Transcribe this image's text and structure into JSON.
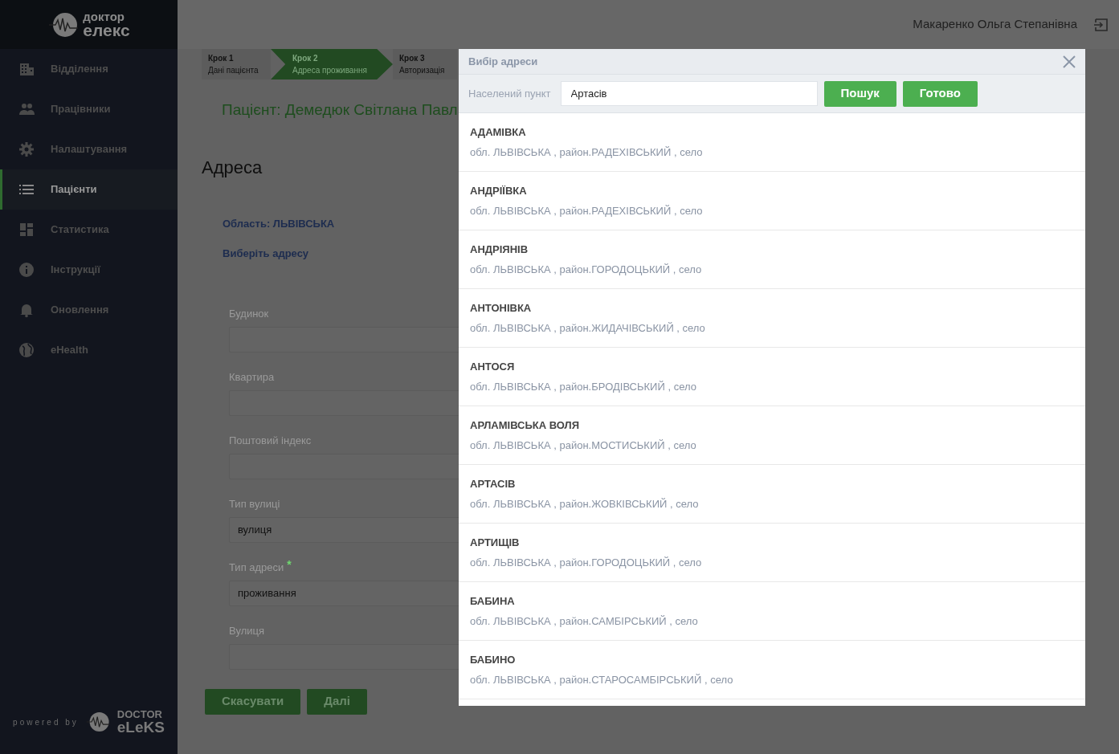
{
  "logo": {
    "line_1": "доктор",
    "line_2": "елекс"
  },
  "sidebar": {
    "items": [
      {
        "label": "Відділення",
        "selected": false
      },
      {
        "label": "Працівники",
        "selected": false
      },
      {
        "label": "Налаштування",
        "selected": false
      },
      {
        "label": "Пацієнти",
        "selected": true
      },
      {
        "label": "Статистика",
        "selected": false
      },
      {
        "label": "Інструкції",
        "selected": false
      },
      {
        "label": "Оновлення",
        "selected": false
      },
      {
        "label": "eHealth",
        "selected": false
      }
    ],
    "footer": {
      "powered_by": "powered by",
      "brand_line_1": "DOCTOR",
      "brand_line_2": "eLeKS"
    }
  },
  "header": {
    "user_name": "Макаренко Ольга Степанівна"
  },
  "steps": [
    {
      "title": "Крок 1",
      "subtitle": "Дані пацієнта",
      "selected": false
    },
    {
      "title": "Крок 2",
      "subtitle": "Адреса проживання",
      "selected": true
    },
    {
      "title": "Крок 3",
      "subtitle": "Авторизація",
      "selected": false
    }
  ],
  "patient_title": "Пацієнт: Демедюк Світлана Павл",
  "section_title": "Адреса",
  "region_label": "Область: ЛЬВІВСЬКА",
  "choose_address_link": "Виберіть адресу",
  "fields": [
    {
      "label": "Будинок",
      "required": false
    },
    {
      "label": "Квартира",
      "required": false
    },
    {
      "label": "Поштовий індекс",
      "required": false
    },
    {
      "label": "Тип вулиці",
      "value": "вулиця",
      "required": false
    },
    {
      "label": "Тип адреси",
      "value": "проживання",
      "required": true
    },
    {
      "label": "Вулиця",
      "required": false
    }
  ],
  "required_mark": "*",
  "buttons": [
    "Скасувати",
    "Далі"
  ],
  "modal": {
    "title": "Вибір адреси",
    "search_label": "Населений пункт",
    "search_value": "Артасів",
    "buttons": [
      "Пошук",
      "Готово"
    ],
    "results": [
      {
        "name": "АДАМІВКА",
        "details": "обл. ЛЬВІВСЬКА , район.РАДЕХІВСЬКИЙ , село"
      },
      {
        "name": "АНДРІЇВКА",
        "details": "обл. ЛЬВІВСЬКА , район.РАДЕХІВСЬКИЙ , село"
      },
      {
        "name": "АНДРІЯНІВ",
        "details": "обл. ЛЬВІВСЬКА , район.ГОРОДОЦЬКИЙ , село"
      },
      {
        "name": "АНТОНІВКА",
        "details": "обл. ЛЬВІВСЬКА , район.ЖИДАЧІВСЬКИЙ , село"
      },
      {
        "name": "АНТОСЯ",
        "details": "обл. ЛЬВІВСЬКА , район.БРОДІВСЬКИЙ , село"
      },
      {
        "name": "АРЛАМІВСЬКА ВОЛЯ",
        "details": "обл. ЛЬВІВСЬКА , район.МОСТИСЬКИЙ , село"
      },
      {
        "name": "АРТАСІВ",
        "details": "обл. ЛЬВІВСЬКА , район.ЖОВКІВСЬКИЙ , село"
      },
      {
        "name": "АРТИЩІВ",
        "details": "обл. ЛЬВІВСЬКА , район.ГОРОДОЦЬКИЙ , село"
      },
      {
        "name": "БАБИНА",
        "details": "обл. ЛЬВІВСЬКА , район.САМБІРСЬКИЙ , село"
      },
      {
        "name": "БАБИНО",
        "details": "обл. ЛЬВІВСЬКА , район.СТАРОСАМБІРСЬКИЙ , село"
      }
    ]
  }
}
